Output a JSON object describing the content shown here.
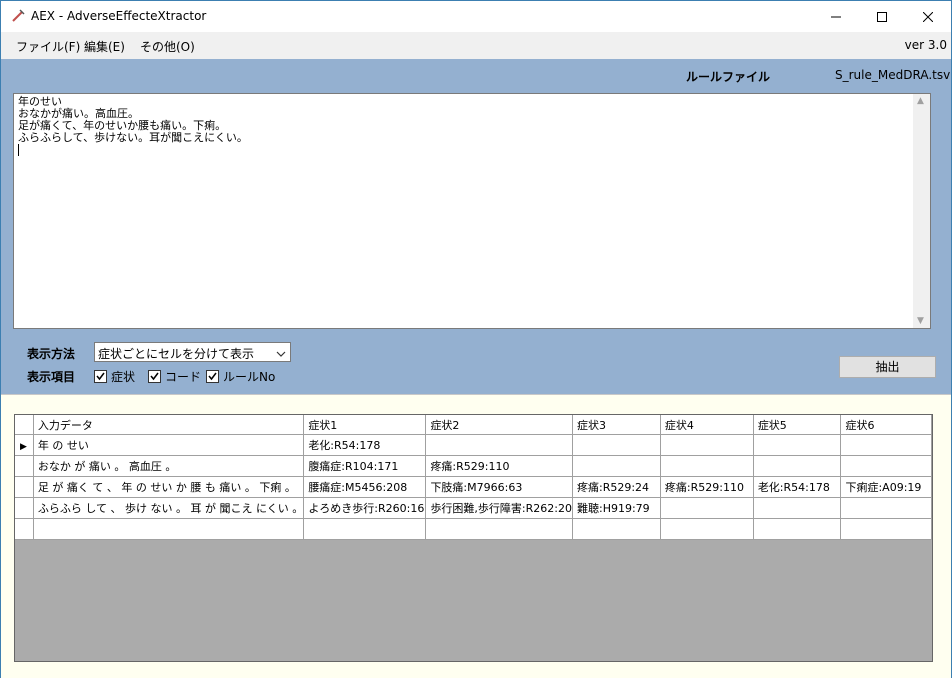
{
  "window": {
    "title": "AEX - AdverseEffecteXtractor"
  },
  "menu": {
    "items": [
      "ファイル(F)",
      "編集(E)",
      "その他(O)"
    ],
    "version": "ver 3.0"
  },
  "rule": {
    "label": "ルールファイル",
    "file": "S_rule_MedDRA.tsv"
  },
  "input": {
    "text": "年のせい\nおなかが痛い。高血圧。\n足が痛くて、年のせいか腰も痛い。下痢。\nふらふらして、歩けない。耳が聞こえにくい。"
  },
  "display": {
    "method_label": "表示方法",
    "method_value": "症状ごとにセルを分けて表示",
    "items_label": "表示項目",
    "checkboxes": [
      {
        "label": "症状",
        "checked": true
      },
      {
        "label": "コード",
        "checked": true
      },
      {
        "label": "ルールNo",
        "checked": true
      }
    ],
    "extract_label": "抽出"
  },
  "grid": {
    "columns": [
      "入力データ",
      "症状1",
      "症状2",
      "症状3",
      "症状4",
      "症状5",
      "症状6"
    ],
    "rows": [
      [
        "年 の せい",
        "老化:R54:178",
        "",
        "",
        "",
        "",
        ""
      ],
      [
        "おなか が 痛い 。 高血圧 。",
        "腹痛症:R104:171",
        "疼痛:R529:110",
        "",
        "",
        "",
        ""
      ],
      [
        "足 が 痛く て 、 年 の せい か 腰 も 痛い 。 下痢 。",
        "腰痛症:M5456:208",
        "下肢痛:M7966:63",
        "疼痛:R529:24",
        "疼痛:R529:110",
        "老化:R54:178",
        "下痢症:A09:19"
      ],
      [
        "ふらふら して 、 歩け ない 。 耳 が 聞こえ にくい 。",
        "よろめき歩行:R260:16",
        "歩行困難,歩行障害:R262:20",
        "難聴:H919:79",
        "",
        "",
        ""
      ]
    ]
  }
}
